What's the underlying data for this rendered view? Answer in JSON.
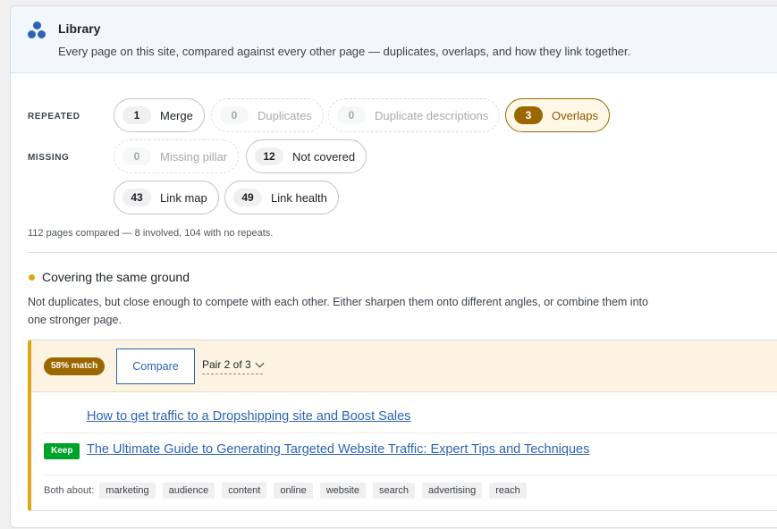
{
  "header": {
    "title": "Library",
    "subtitle": "Every page on this site, compared against every other page — duplicates, overlaps, and how they link together."
  },
  "filters": {
    "repeated_label": "REPEATED",
    "missing_label": "MISSING",
    "merge": {
      "count": "1",
      "label": "Merge"
    },
    "duplicates": {
      "count": "0",
      "label": "Duplicates"
    },
    "duplicate_descriptions": {
      "count": "0",
      "label": "Duplicate descriptions"
    },
    "overlaps": {
      "count": "3",
      "label": "Overlaps"
    },
    "missing_pillar": {
      "count": "0",
      "label": "Missing pillar"
    },
    "not_covered": {
      "count": "12",
      "label": "Not covered"
    },
    "link_map": {
      "count": "43",
      "label": "Link map"
    },
    "link_health": {
      "count": "49",
      "label": "Link health"
    }
  },
  "stats": "112 pages compared — 8 involved, 104 with no repeats.",
  "section": {
    "title": "Covering the same ground",
    "description": "Not duplicates, but close enough to compete with each other. Either sharpen them onto different angles, or combine them into one stronger page."
  },
  "card": {
    "match": "58% match",
    "compare_label": "Compare",
    "pair_label": "Pair 2 of 3",
    "page1": "How to get traffic to a Dropshipping site and Boost Sales",
    "keep_badge": "Keep",
    "page2": "The Ultimate Guide to Generating Targeted Website Traffic: Expert Tips and Techniques",
    "about_label": "Both about:",
    "tags": [
      "marketing",
      "audience",
      "content",
      "online",
      "website",
      "search",
      "advertising",
      "reach"
    ]
  },
  "colors": {
    "accent_blue": "#2c63b5",
    "overlap_brown": "#9a6700",
    "section_dot": "#dba617",
    "keep_green": "#00a32a"
  },
  "icons": {
    "logo": "library-dots-icon",
    "pair_toggle": "chevron-down-icon"
  }
}
